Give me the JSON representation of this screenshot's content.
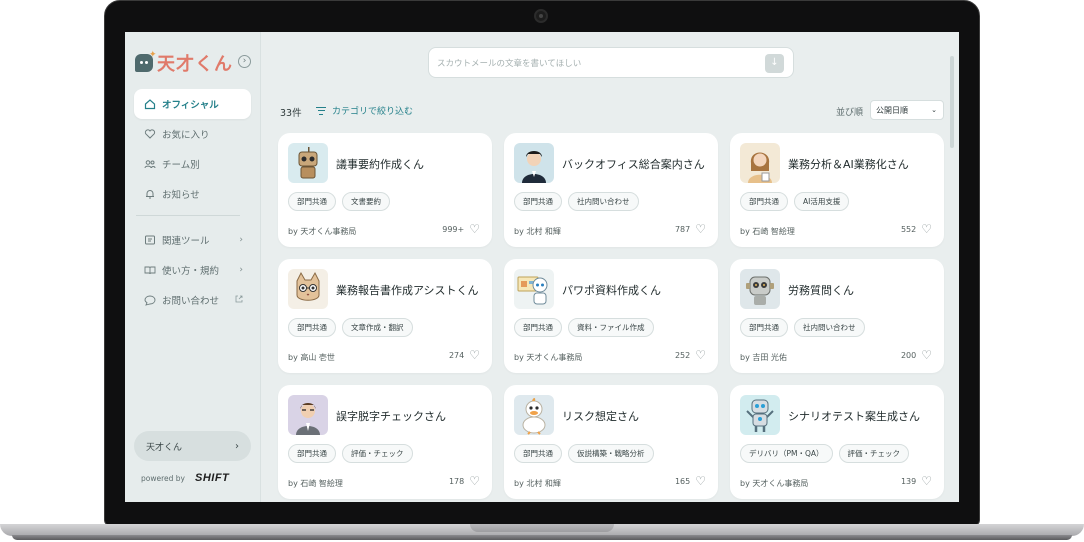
{
  "app": {
    "logo_text": "天才くん",
    "collapse_icon": "chevron-right-circle-icon"
  },
  "sidebar": {
    "items": [
      {
        "label": "オフィシャル",
        "icon": "home-icon",
        "active": true
      },
      {
        "label": "お気に入り",
        "icon": "heart-icon"
      },
      {
        "label": "チーム別",
        "icon": "team-icon"
      },
      {
        "label": "お知らせ",
        "icon": "bell-icon"
      },
      {
        "label": "関連ツール",
        "icon": "tools-icon",
        "tail": "›"
      },
      {
        "label": "使い方・規約",
        "icon": "book-icon",
        "tail": "›"
      },
      {
        "label": "お問い合わせ",
        "icon": "chat-icon",
        "tail": "external-link-icon"
      }
    ],
    "profile_label": "天才くん",
    "powered_by": "powered by",
    "brand": "SHIFT"
  },
  "search": {
    "placeholder": "スカウトメールの文章を書いてほしい"
  },
  "toolbar": {
    "count": "33件",
    "filter_label": "カテゴリで絞り込む",
    "sort_label": "並び順",
    "sort_value": "公開日順"
  },
  "cards": [
    {
      "title": "議事要約作成くん",
      "tags": [
        "部門共通",
        "文書要約"
      ],
      "author": "by 天才くん事務局",
      "likes": "999+"
    },
    {
      "title": "バックオフィス総合案内さん",
      "tags": [
        "部門共通",
        "社内問い合わせ"
      ],
      "author": "by 北村 和輝",
      "likes": "787"
    },
    {
      "title": "業務分析＆AI業務化さん",
      "tags": [
        "部門共通",
        "AI活用支援"
      ],
      "author": "by 石崎 智絵理",
      "likes": "552"
    },
    {
      "title": "業務報告書作成アシストくん",
      "tags": [
        "部門共通",
        "文章作成・翻訳"
      ],
      "author": "by 高山 壱世",
      "likes": "274"
    },
    {
      "title": "パワポ資料作成くん",
      "tags": [
        "部門共通",
        "資料・ファイル作成"
      ],
      "author": "by 天才くん事務局",
      "likes": "252"
    },
    {
      "title": "労務質問くん",
      "tags": [
        "部門共通",
        "社内問い合わせ"
      ],
      "author": "by 吉田 光佑",
      "likes": "200"
    },
    {
      "title": "誤字脱字チェックさん",
      "tags": [
        "部門共通",
        "評価・チェック"
      ],
      "author": "by 石崎 智絵理",
      "likes": "178"
    },
    {
      "title": "リスク想定さん",
      "tags": [
        "部門共通",
        "仮説構築・戦略分析"
      ],
      "author": "by 北村 和輝",
      "likes": "165"
    },
    {
      "title": "シナリオテスト案生成さん",
      "tags": [
        "デリバリ（PM・QA）",
        "評価・チェック"
      ],
      "author": "by 天才くん事務局",
      "likes": "139"
    }
  ]
}
